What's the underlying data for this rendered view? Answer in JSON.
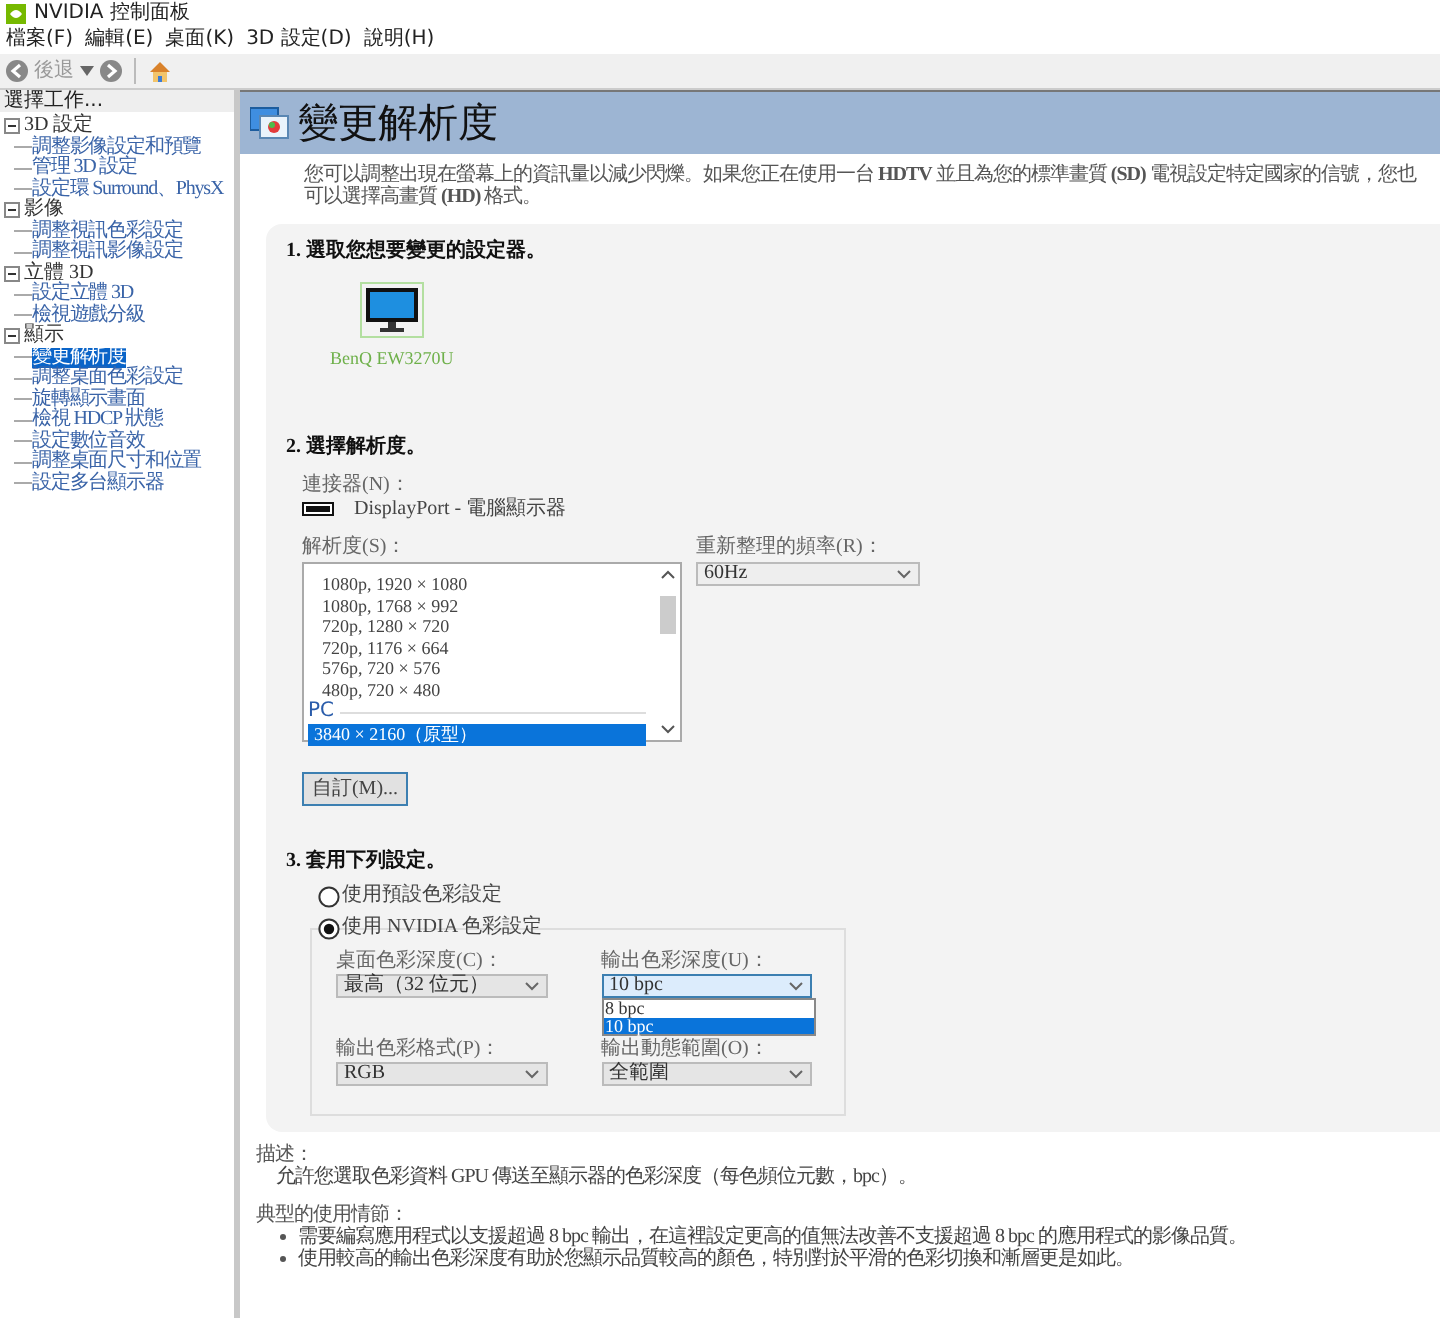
{
  "window": {
    "title": "NVIDIA 控制面板"
  },
  "menu_bar": [
    "檔案(F)",
    "編輯(E)",
    "桌面(K)",
    "3D 設定(D)",
    "說明(H)"
  ],
  "toolbar": {
    "back": "後退"
  },
  "sidebar": {
    "header": "選擇工作...",
    "tree": [
      {
        "label": "3D 設定",
        "expanded": true,
        "children": [
          {
            "label": "調整影像設定和預覽",
            "selected": false
          },
          {
            "label": "管理 3D 設定",
            "selected": false
          },
          {
            "label": "設定環 Surround、PhysX",
            "selected": false
          }
        ]
      },
      {
        "label": "影像",
        "expanded": true,
        "children": [
          {
            "label": "調整視訊色彩設定",
            "selected": false
          },
          {
            "label": "調整視訊影像設定",
            "selected": false
          }
        ]
      },
      {
        "label": "立體 3D",
        "expanded": true,
        "children": [
          {
            "label": "設定立體 3D",
            "selected": false
          },
          {
            "label": "檢視遊戲分級",
            "selected": false
          }
        ]
      },
      {
        "label": "顯示",
        "expanded": true,
        "children": [
          {
            "label": "變更解析度",
            "selected": true
          },
          {
            "label": "調整桌面色彩設定",
            "selected": false
          },
          {
            "label": "旋轉顯示畫面",
            "selected": false
          },
          {
            "label": "檢視 HDCP 狀態",
            "selected": false
          },
          {
            "label": "設定數位音效",
            "selected": false
          },
          {
            "label": "調整桌面尺寸和位置",
            "selected": false
          },
          {
            "label": "設定多台顯示器",
            "selected": false
          }
        ]
      }
    ]
  },
  "page": {
    "title": "變更解析度",
    "intro": "您可以調整出現在螢幕上的資訊量以減少閃爍。如果您正在使用一台 **HDTV** 並且為您的標準畫質 **(SD)** 電視設定特定國家的信號，您也可以選擇高畫質 **(HD)** 格式。"
  },
  "section_1": {
    "heading": "1. 選取您想要變更的設定器。",
    "displays": [
      {
        "label": "BenQ EW3270U",
        "selected": true
      }
    ]
  },
  "section_2": {
    "heading": "2. 選擇解析度。",
    "connector_label": "連接器(N)：",
    "connector": "DisplayPort - 電腦顯示器",
    "resolution_label": "解析度(S)：",
    "resolutions": [
      {
        "kind": "item",
        "label": "1080p, 1920 × 1080",
        "selected": false
      },
      {
        "kind": "item",
        "label": "1080p, 1768 × 992",
        "selected": false
      },
      {
        "kind": "item",
        "label": "720p, 1280 × 720",
        "selected": false
      },
      {
        "kind": "item",
        "label": "720p, 1176 × 664",
        "selected": false
      },
      {
        "kind": "item",
        "label": "576p, 720 × 576",
        "selected": false
      },
      {
        "kind": "item",
        "label": "480p, 720 × 480",
        "selected": false
      },
      {
        "kind": "group",
        "label": "PC"
      },
      {
        "kind": "item",
        "label": "3840 × 2160（原型）",
        "selected": true
      }
    ],
    "refresh_label": "重新整理的頻率(R)：",
    "refresh": "60Hz",
    "customize_button": "自訂(M)..."
  },
  "section_3": {
    "heading": "3. 套用下列設定。",
    "options": [
      {
        "label": "使用預設色彩設定",
        "selected": false
      },
      {
        "label": "使用 NVIDIA 色彩設定",
        "selected": true
      }
    ],
    "desktop_depth": {
      "label": "桌面色彩深度(C)：",
      "value": "最高（32 位元）"
    },
    "output_depth": {
      "label": "輸出色彩深度(U)：",
      "value": "10 bpc",
      "expanded": true,
      "options": [
        {
          "label": "8 bpc",
          "selected": false
        },
        {
          "label": "10 bpc",
          "selected": true
        }
      ]
    },
    "output_format": {
      "label": "輸出色彩格式(P)：",
      "value": "RGB"
    },
    "output_range": {
      "label": "輸出動態範圍(O)：",
      "value": "全範圍"
    }
  },
  "description": {
    "label": "描述：",
    "text": "允許您選取色彩資料 GPU 傳送至顯示器的色彩深度（每色頻位元數，bpc）。"
  },
  "usage": {
    "label": "典型的使用情節：",
    "bullets": [
      "需要編寫應用程式以支援超過 8 bpc 輸出，在這裡設定更高的值無法改善不支援超過 8 bpc 的應用程式的影像品質。",
      "使用較高的輸出色彩深度有助於您顯示品質較高的顏色，特別對於平滑的色彩切換和漸層更是如此。"
    ]
  }
}
